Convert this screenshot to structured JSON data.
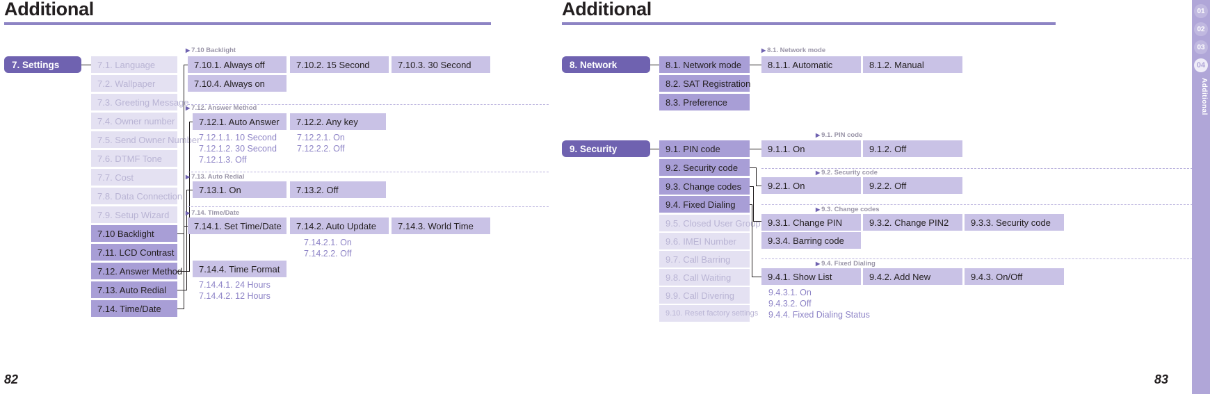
{
  "left_page": {
    "title": "Additional",
    "page_number": "82",
    "root": {
      "label": "7. Settings"
    },
    "menu_items": [
      {
        "label": "7.1. Language",
        "state": "ghost"
      },
      {
        "label": "7.2. Wallpaper",
        "state": "ghost"
      },
      {
        "label": "7.3. Greeting Message",
        "state": "ghost"
      },
      {
        "label": "7.4. Owner number",
        "state": "ghost"
      },
      {
        "label": "7.5. Send Owner Number",
        "state": "ghost"
      },
      {
        "label": "7.6. DTMF Tone",
        "state": "ghost"
      },
      {
        "label": "7.7. Cost",
        "state": "ghost"
      },
      {
        "label": "7.8. Data Connection",
        "state": "ghost"
      },
      {
        "label": "7.9. Setup Wizard",
        "state": "ghost"
      },
      {
        "label": "7.10 Backlight",
        "state": "mid"
      },
      {
        "label": "7.11. LCD Contrast",
        "state": "mid"
      },
      {
        "label": "7.12. Answer Method",
        "state": "mid"
      },
      {
        "label": "7.13. Auto Redial",
        "state": "mid"
      },
      {
        "label": "7.14. Time/Date",
        "state": "mid"
      }
    ],
    "groups": [
      {
        "caption": "7.10 Backlight",
        "boxes": [
          {
            "label": "7.10.1. Always off"
          },
          {
            "label": "7.10.2. 15 Second"
          },
          {
            "label": "7.10.3. 30 Second"
          },
          {
            "label": "7.10.4. Always on"
          }
        ],
        "leaves": []
      },
      {
        "caption": "7.12. Answer Method",
        "boxes": [
          {
            "label": "7.12.1. Auto Answer"
          },
          {
            "label": "7.12.2. Any key"
          }
        ],
        "leaves": [
          "7.12.1.1. 10 Second",
          "7.12.1.2. 30 Second",
          "7.12.1.3. Off",
          "7.12.2.1. On",
          "7.12.2.2. Off"
        ]
      },
      {
        "caption": "7.13. Auto Redial",
        "boxes": [
          {
            "label": "7.13.1. On"
          },
          {
            "label": "7.13.2. Off"
          }
        ],
        "leaves": []
      },
      {
        "caption": "7.14. Time/Date",
        "boxes": [
          {
            "label": "7.14.1. Set Time/Date"
          },
          {
            "label": "7.14.2. Auto Update"
          },
          {
            "label": "7.14.3. World Time"
          },
          {
            "label": "7.14.4. Time Format"
          }
        ],
        "leaves": [
          "7.14.2.1. On",
          "7.14.2.2. Off",
          "7.14.4.1. 24 Hours",
          "7.14.4.2. 12 Hours"
        ]
      }
    ]
  },
  "right_page": {
    "title": "Additional",
    "page_number": "83",
    "network": {
      "root": {
        "label": "8. Network"
      },
      "menu_items": [
        {
          "label": "8.1. Network mode",
          "state": "mid"
        },
        {
          "label": "8.2. SAT Registration",
          "state": "mid"
        },
        {
          "label": "8.3. Preference",
          "state": "mid"
        }
      ],
      "groups": [
        {
          "caption": "8.1. Network mode",
          "boxes": [
            {
              "label": "8.1.1. Automatic"
            },
            {
              "label": "8.1.2. Manual"
            }
          ]
        }
      ]
    },
    "security": {
      "root": {
        "label": "9. Security"
      },
      "menu_items": [
        {
          "label": "9.1. PIN code",
          "state": "mid"
        },
        {
          "label": "9.2. Security code",
          "state": "mid"
        },
        {
          "label": "9.3. Change codes",
          "state": "mid"
        },
        {
          "label": "9.4. Fixed Dialing",
          "state": "mid"
        },
        {
          "label": "9.5. Closed User Group",
          "state": "ghost"
        },
        {
          "label": "9.6. IMEI Number",
          "state": "ghost"
        },
        {
          "label": "9.7. Call Barring",
          "state": "ghost"
        },
        {
          "label": "9.8. Call Waiting",
          "state": "ghost"
        },
        {
          "label": "9.9. Call Divering",
          "state": "ghost"
        },
        {
          "label": "9.10. Reset factory settings",
          "state": "ghost"
        }
      ],
      "groups": [
        {
          "caption": "9.1. PIN code",
          "boxes": [
            {
              "label": "9.1.1. On"
            },
            {
              "label": "9.1.2. Off"
            }
          ],
          "leaves": []
        },
        {
          "caption": "9.2. Security code",
          "boxes": [
            {
              "label": "9.2.1. On"
            },
            {
              "label": "9.2.2. Off"
            }
          ],
          "leaves": []
        },
        {
          "caption": "9.3. Change codes",
          "boxes": [
            {
              "label": "9.3.1. Change PIN"
            },
            {
              "label": "9.3.2. Change PIN2"
            },
            {
              "label": "9.3.3. Security code"
            },
            {
              "label": "9.3.4. Barring code"
            }
          ],
          "leaves": []
        },
        {
          "caption": "9.4. Fixed Dialing",
          "boxes": [
            {
              "label": "9.4.1. Show List"
            },
            {
              "label": "9.4.2. Add New"
            },
            {
              "label": "9.4.3. On/Off"
            }
          ],
          "leaves": [
            "9.4.3.1. On",
            "9.4.3.2. Off",
            "9.4.4. Fixed Dialing Status"
          ]
        }
      ]
    }
  },
  "tabstrip": {
    "numbers": [
      "01",
      "02",
      "03",
      "04"
    ],
    "active_index": 3,
    "label": "Additional"
  },
  "colors": {
    "root": "#6f62b0",
    "mid": "#a89ed6",
    "pale": "#c9c2e6",
    "ghost": "#e4e1f2",
    "rule": "#8d84c4",
    "leaf_text": "#8d83c6"
  }
}
